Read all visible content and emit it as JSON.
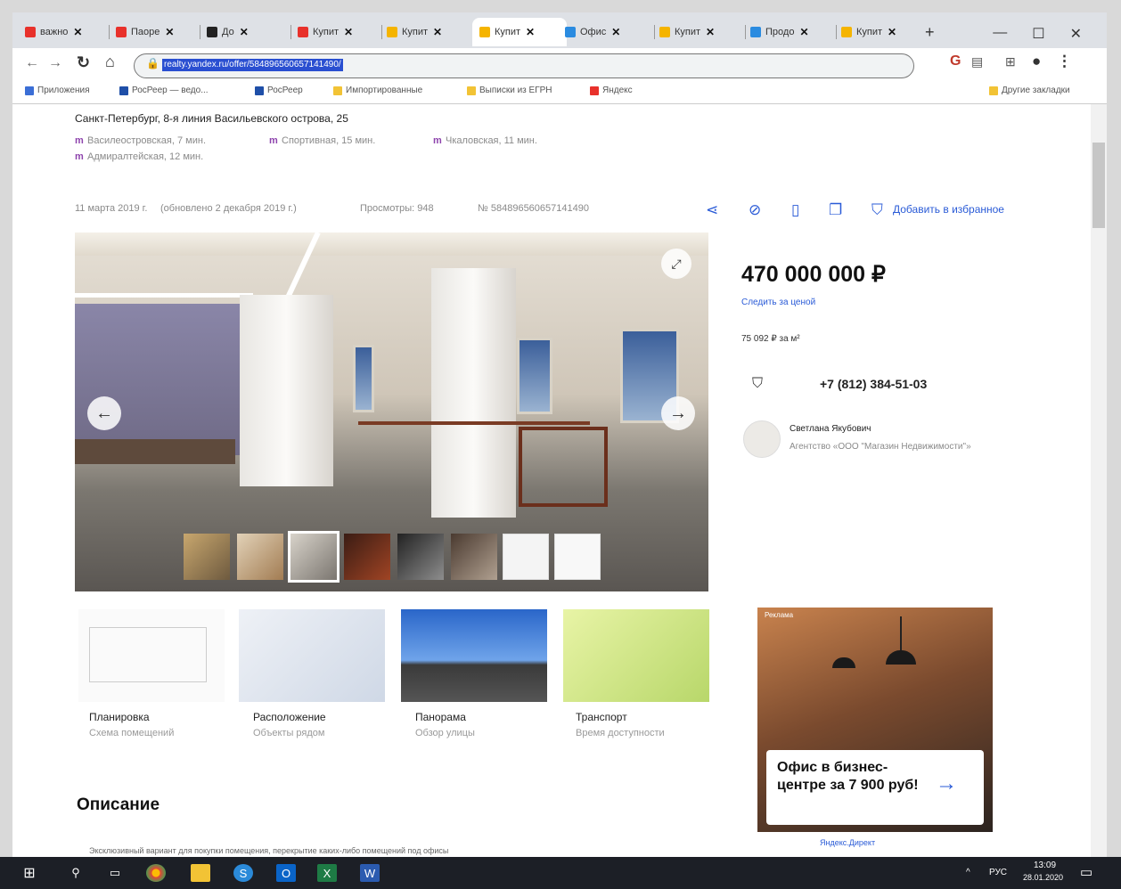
{
  "browser": {
    "tabs": [
      {
        "label": "важно",
        "color": "#e8312b",
        "active": false
      },
      {
        "label": "Паоре",
        "color": "#e8312b",
        "active": false
      },
      {
        "label": "До",
        "color": "#222222",
        "active": false
      },
      {
        "label": "Купит",
        "color": "#e8312b",
        "active": false
      },
      {
        "label": "Купит",
        "color": "#f5b400",
        "active": false
      },
      {
        "label": "Купит",
        "color": "#f5b400",
        "active": true
      },
      {
        "label": "Офис",
        "color": "#2a8be0",
        "active": false
      },
      {
        "label": "Купит",
        "color": "#f5b400",
        "active": false
      },
      {
        "label": "Продо",
        "color": "#2a8be0",
        "active": false
      },
      {
        "label": "Купит",
        "color": "#f5b400",
        "active": false
      }
    ],
    "new_tab": "+",
    "window_controls": [
      "—",
      "☐",
      "✕"
    ],
    "url": "realty.yandex.ru/offer/584896560657141490/",
    "bookmarks": [
      {
        "label": "Приложения",
        "color": "#3b6ed6"
      },
      {
        "label": "РосРеер — ведо...",
        "color": "#1f4fa8"
      },
      {
        "label": "РосРеер",
        "color": "#1f4fa8"
      },
      {
        "label": "Импортированные",
        "color": "#f2c335"
      },
      {
        "label": "Выписки из ЕГРН",
        "color": "#f2c335"
      },
      {
        "label": "Яндекс",
        "color": "#e8312b"
      }
    ],
    "other_bookmarks": "Другие закладки"
  },
  "listing": {
    "address": "Санкт-Петербург, 8-я линия Васильевского острова, 25",
    "metro": [
      {
        "name": "Василеостровская, 7 мин.",
        "color": "#3fa34d"
      },
      {
        "name": "Спортивная, 15 мин.",
        "color": "#8e44ad"
      },
      {
        "name": "Чкаловская, 11 мин.",
        "color": "#8e44ad"
      },
      {
        "name": "Адмиралтейская, 12 мин.",
        "color": "#8e44ad"
      }
    ],
    "meta": {
      "date": "11 марта 2019 г.",
      "updated": "(обновлено 2 декабря 2019 г.)",
      "views": "Просмотры: 948",
      "offer_id": "№ 584896560657141490"
    },
    "add_favorite": "Добавить в избранное",
    "action_icons": [
      "share-icon",
      "block-icon",
      "report-icon",
      "copy-icon",
      "bookmark-icon"
    ],
    "price": "470 000 000 ₽",
    "price_watch": "Следить за ценой",
    "price_per_m2": "75 092 ₽ за м²",
    "phone": "+7 (812) 384-51-03",
    "agent_name": "Светлана Якубович",
    "agent_company": "Агентство «ООО \"Магазин Недвижимости\"»",
    "cards": [
      {
        "title": "Планировка",
        "sub": "Схема помещений"
      },
      {
        "title": "Расположение",
        "sub": "Объекты рядом"
      },
      {
        "title": "Панорама",
        "sub": "Обзор улицы"
      },
      {
        "title": "Транспорт",
        "sub": "Время доступности"
      }
    ],
    "section_title": "Описание",
    "description_start": "Эксклюзивный вариант для покупки помещения, перекрытие каких-либо помещений под офисы"
  },
  "ad": {
    "label": "Реклама",
    "text": "Офис в бизнес-центре за 7 900 руб!",
    "footer": "Яндекс.Директ"
  },
  "taskbar": {
    "lang": "РУС",
    "time": "13:09",
    "date": "28.01.2020",
    "apps": [
      "start-icon",
      "search-icon",
      "task-view-icon",
      "chrome-icon",
      "file-explorer-icon",
      "skype-icon",
      "outlook-icon",
      "excel-icon",
      "word-icon"
    ]
  }
}
